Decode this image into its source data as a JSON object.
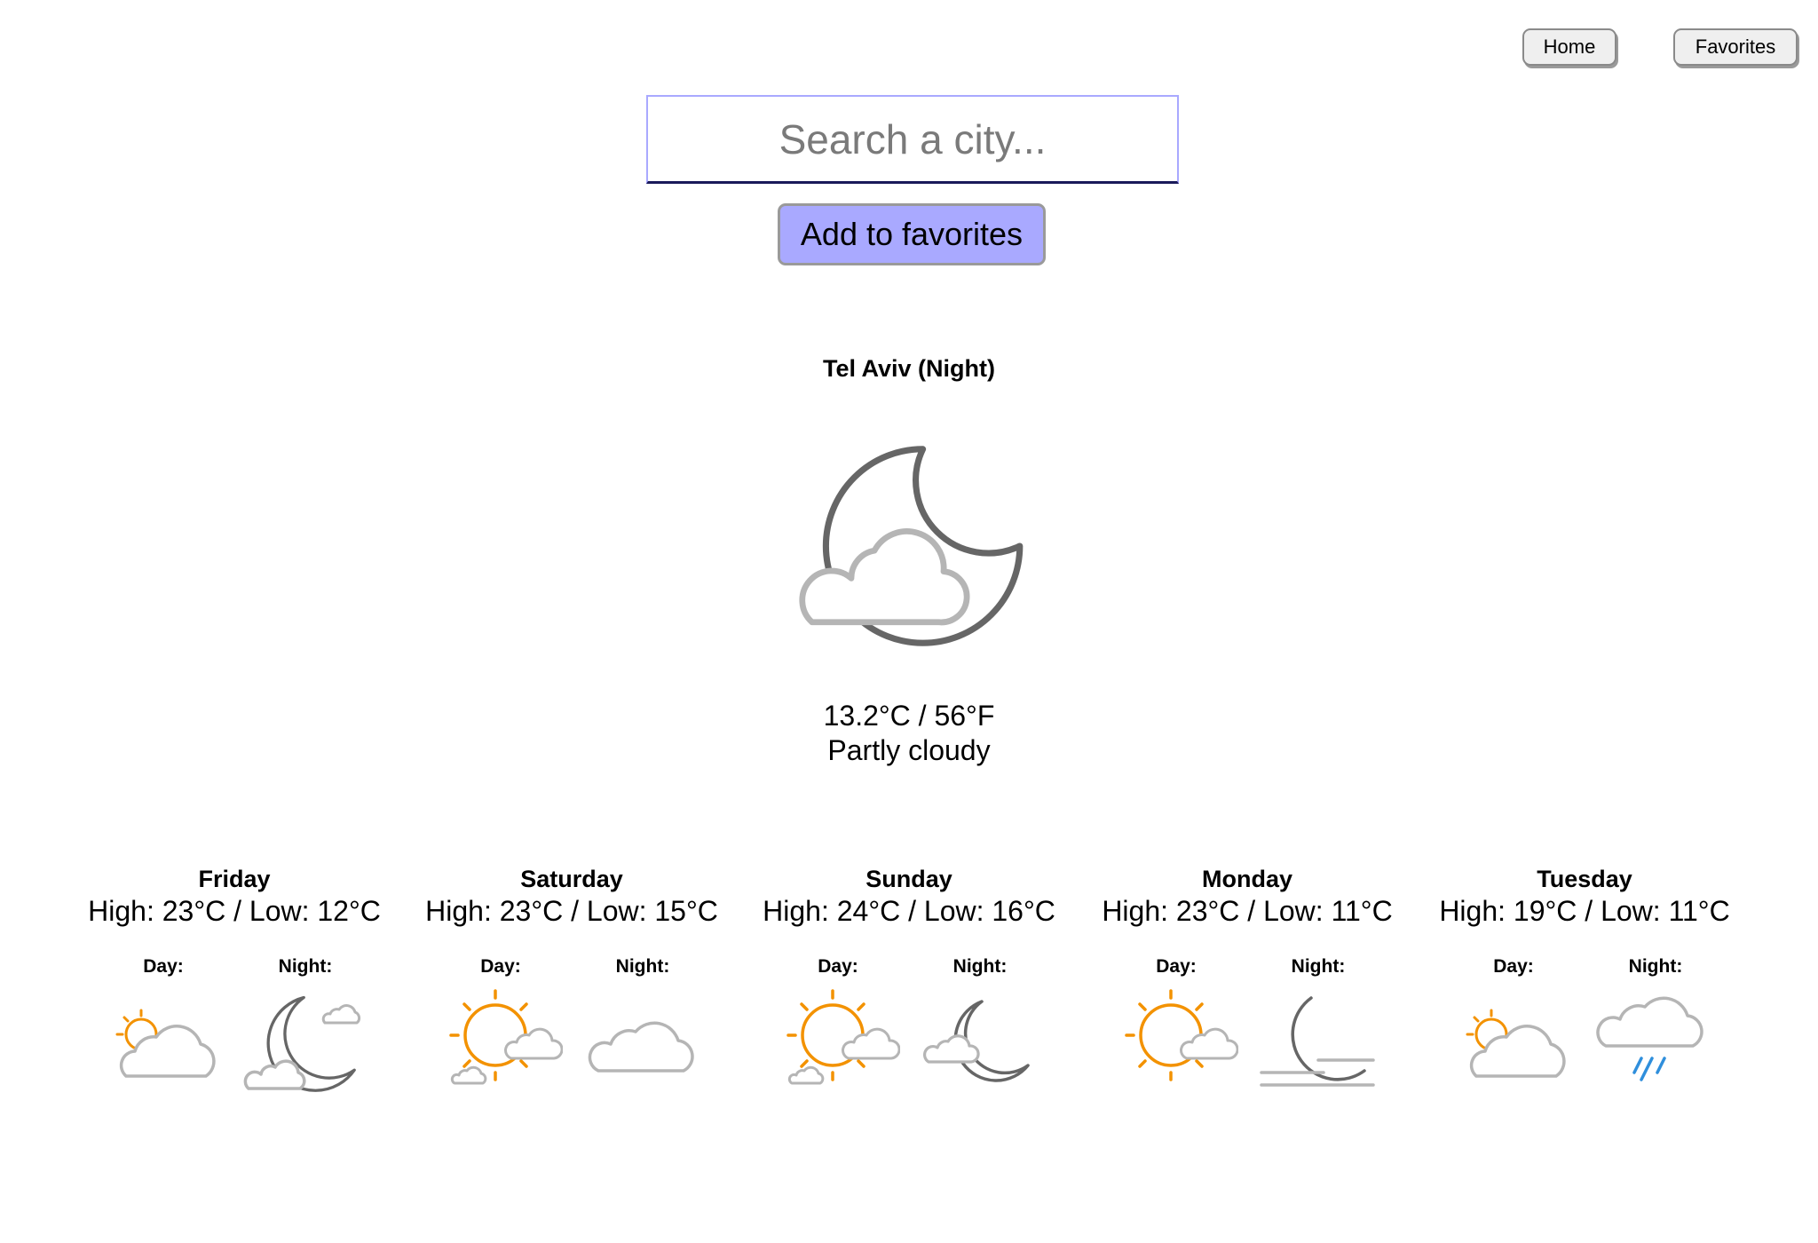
{
  "nav": {
    "home_label": "Home",
    "favorites_label": "Favorites"
  },
  "search": {
    "placeholder": "Search a city...",
    "value": ""
  },
  "add_favorites_label": "Add to favorites",
  "current": {
    "title": "Tel Aviv (Night)",
    "temperature": "13.2°C / 56°F",
    "condition": "Partly cloudy",
    "icon": "moon-cloud-icon"
  },
  "forecast": [
    {
      "day": "Friday",
      "hilo": "High: 23°C / Low: 12°C",
      "day_label": "Day:",
      "night_label": "Night:",
      "day_icon": "sun-behind-cloud-icon",
      "night_icon": "moon-clouds-icon"
    },
    {
      "day": "Saturday",
      "hilo": "High: 23°C / Low: 15°C",
      "day_label": "Day:",
      "night_label": "Night:",
      "day_icon": "sun-cloud-icon",
      "night_icon": "cloud-icon"
    },
    {
      "day": "Sunday",
      "hilo": "High: 24°C / Low: 16°C",
      "day_label": "Day:",
      "night_label": "Night:",
      "day_icon": "sun-cloud-icon",
      "night_icon": "moon-cloud-icon"
    },
    {
      "day": "Monday",
      "hilo": "High: 23°C / Low: 11°C",
      "day_label": "Day:",
      "night_label": "Night:",
      "day_icon": "sun-cloud-icon",
      "night_icon": "moon-fog-icon"
    },
    {
      "day": "Tuesday",
      "hilo": "High: 19°C / Low: 11°C",
      "day_label": "Day:",
      "night_label": "Night:",
      "day_icon": "sun-behind-cloud-icon",
      "night_icon": "rain-cloud-icon"
    }
  ],
  "colors": {
    "accent": "#a9a9ff",
    "sun": "#f39200",
    "moon": "#666666",
    "cloud": "#b5b5b5",
    "rain": "#2f8fdc"
  }
}
